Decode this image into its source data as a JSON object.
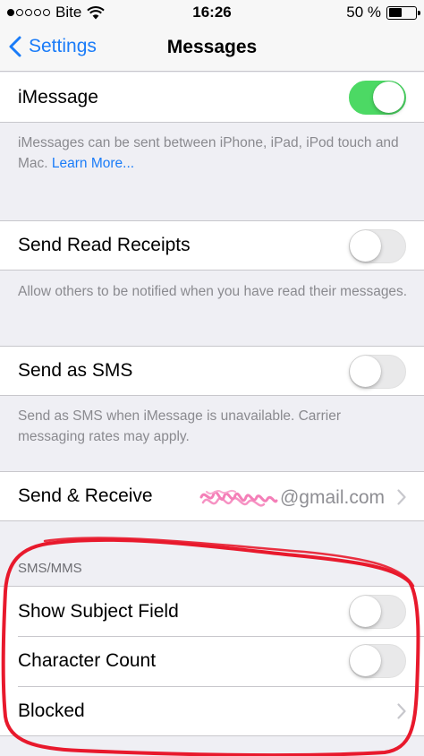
{
  "status_bar": {
    "carrier": "Bite",
    "time": "16:26",
    "battery_percent": "50 %",
    "battery_level": 0.5,
    "signal_bars": 1,
    "wifi_icon": "wifi-icon"
  },
  "nav": {
    "back_label": "Settings",
    "back_icon": "chevron-left-icon",
    "title": "Messages"
  },
  "imessage": {
    "label": "iMessage",
    "enabled": true,
    "footer_text": "iMessages can be sent between iPhone, iPad, iPod touch and Mac. ",
    "footer_link": "Learn More..."
  },
  "read_receipts": {
    "label": "Send Read Receipts",
    "enabled": false,
    "footer_text": "Allow others to be notified when you have read their messages."
  },
  "send_as_sms": {
    "label": "Send as SMS",
    "enabled": false,
    "footer_text": "Send as SMS when iMessage is unavailable. Carrier messaging rates may apply."
  },
  "send_receive": {
    "label": "Send & Receive",
    "value_suffix": "@gmail.com"
  },
  "sms_mms": {
    "header": "SMS/MMS",
    "show_subject": {
      "label": "Show Subject Field",
      "enabled": false
    },
    "character_count": {
      "label": "Character Count",
      "enabled": false
    },
    "blocked": {
      "label": "Blocked"
    }
  },
  "colors": {
    "accent": "#1a7cf8",
    "toggle_on": "#4cd964",
    "annotation": "#e8192c",
    "scribble": "#f47fb8"
  }
}
